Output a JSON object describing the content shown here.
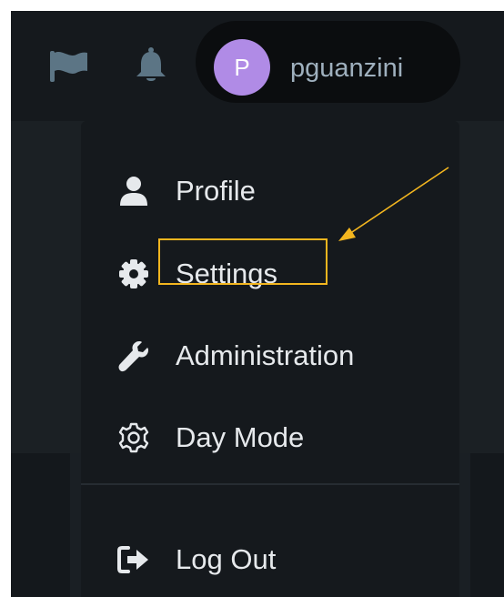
{
  "header": {
    "user": {
      "avatar_letter": "P",
      "username": "pguanzini",
      "avatar_color": "#b08be6"
    },
    "icons": [
      "flag-icon",
      "bell-icon"
    ]
  },
  "menu": {
    "items": [
      {
        "label": "Profile",
        "icon": "user-icon"
      },
      {
        "label": "Settings",
        "icon": "gear-icon"
      },
      {
        "label": "Administration",
        "icon": "wrench-icon"
      },
      {
        "label": "Day Mode",
        "icon": "gear-outline-icon"
      },
      {
        "label": "Log Out",
        "icon": "logout-icon"
      }
    ],
    "highlighted_item": "Settings"
  },
  "annotation": {
    "color": "#f3b61f"
  }
}
